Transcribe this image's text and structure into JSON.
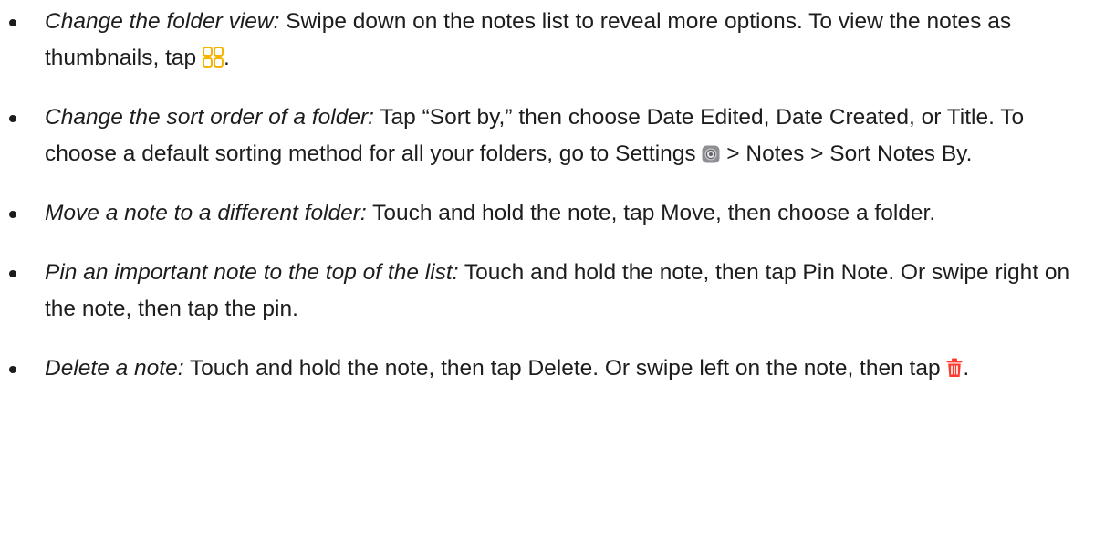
{
  "items": [
    {
      "lead": "Change the folder view:",
      "before_icon": " Swipe down on the notes list to reveal more options. To view the notes as thumbnails, tap ",
      "icon": "gallery-grid-icon",
      "after_icon": "."
    },
    {
      "lead": "Change the sort order of a folder:",
      "before_icon": " Tap “Sort by,” then choose Date Edited, Date Created, or Title. To choose a default sorting method for all your folders, go to Settings ",
      "icon": "settings-gear-icon",
      "after_icon": " > Notes > Sort Notes By."
    },
    {
      "lead": "Move a note to a different folder:",
      "text": " Touch and hold the note, tap Move, then choose a folder."
    },
    {
      "lead": "Pin an important note to the top of the list:",
      "text": " Touch and hold the note, then tap Pin Note. Or swipe right on the note, then tap the pin."
    },
    {
      "lead": "Delete a note:",
      "before_icon": " Touch and hold the note, then tap Delete. Or swipe left on the note, then tap ",
      "icon": "trash-icon",
      "after_icon": "."
    }
  ],
  "colors": {
    "text": "#1d1d1f",
    "gallery_icon": "#f5b400",
    "trash_icon": "#ff3b30",
    "settings_icon": "#8e8e93"
  }
}
